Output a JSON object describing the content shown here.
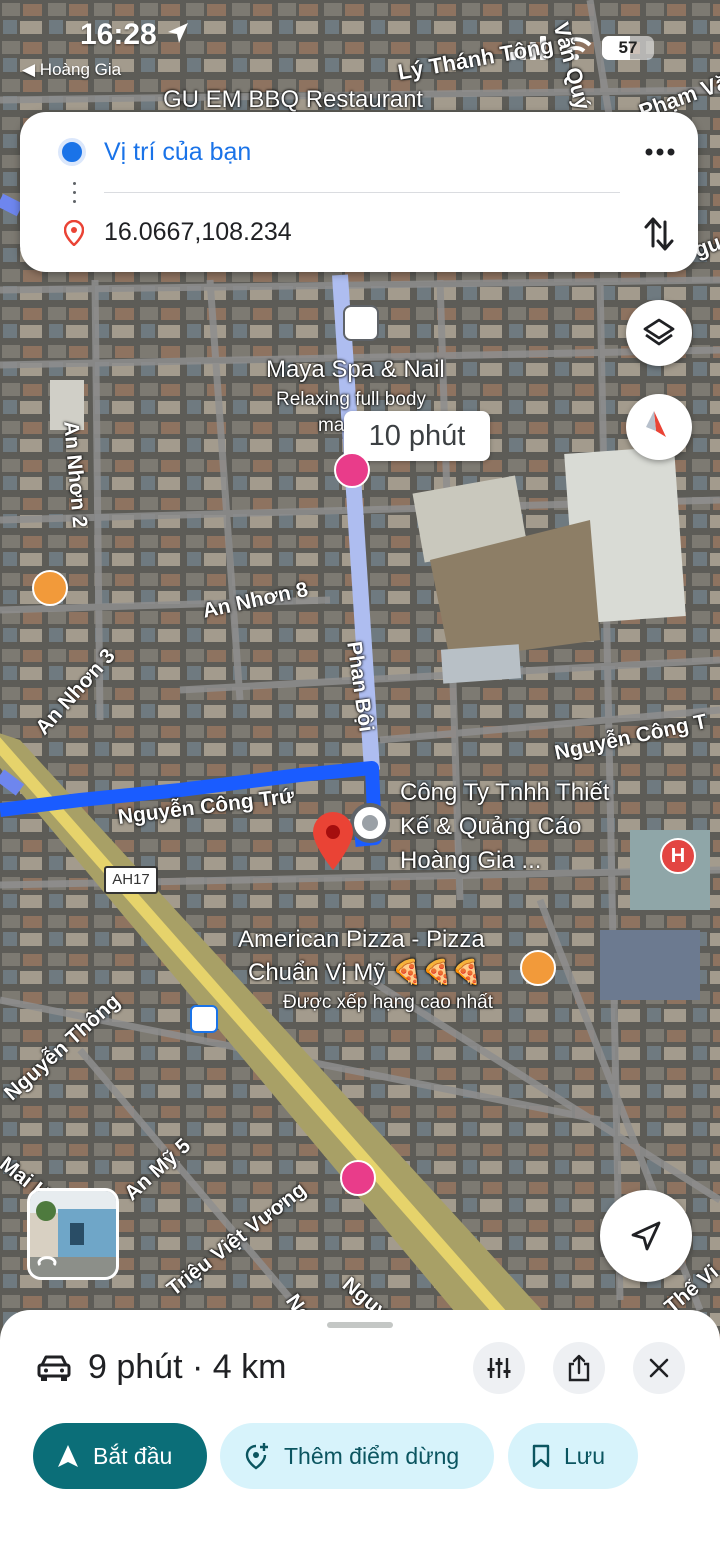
{
  "status_bar": {
    "time": "16:28",
    "back_app": "◀ Hoàng Gia",
    "battery": "57"
  },
  "route_card": {
    "origin": "Vị trí của bạn",
    "destination": "16.0667,108.234",
    "more_icon": "more-vert-icon",
    "swap_icon": "swap-icon"
  },
  "map": {
    "time_bubble": "10 phút",
    "places": {
      "gu_em": "GU EM BBQ Restaurant",
      "maya": "Maya Spa & Nail",
      "maya_sub": "Relaxing full body",
      "maya_sub2": "ma",
      "company_line1": "Công Ty Tnhh Thiết",
      "company_line2": "Kế & Quảng Cáo",
      "company_line3": "Hoàng Gia ...",
      "pizza_line1": "American Pizza - Pizza",
      "pizza_line2": "Chuẩn Vị Mỹ 🍕🍕🍕",
      "pizza_rating": "Được xếp hạng cao nhất"
    },
    "roads": {
      "ly_thanh_tong": "Lý Thánh Tông",
      "van_quy": "Văn Quý",
      "pham_van": "Phạm Vă",
      "an_nhon_2": "An Nhơn 2",
      "an_nhon_8": "An Nhơn 8",
      "an_nhon_3": "An Nhơn 3",
      "phan_boi": "Phan Bội",
      "nguyen_cong_tru": "Nguyễn Công Trứ",
      "nguyen_cong_t": "Nguyễn Công T",
      "nguyen_thong": "Nguyễn Thông",
      "mai_h": "Mai H",
      "an_my_5": "An Mỹ 5",
      "trieu_viet_vuong": "Triệu Việt Vương",
      "nguy": "Nguy",
      "ng": "Ng",
      "the_vi": "Thế Vi",
      "gu": "gu"
    },
    "highway_badge": "AH17"
  },
  "bottom_sheet": {
    "trip_summary": "9 phút · 4 km",
    "start_label": "Bắt đầu",
    "add_stop_label": "Thêm điểm dừng",
    "save_label": "Lưu"
  },
  "colors": {
    "route_blue": "#1a5cff",
    "start_button": "#0b6e78",
    "secondary_button": "#d7f3fb",
    "pin_red": "#ea4335"
  }
}
